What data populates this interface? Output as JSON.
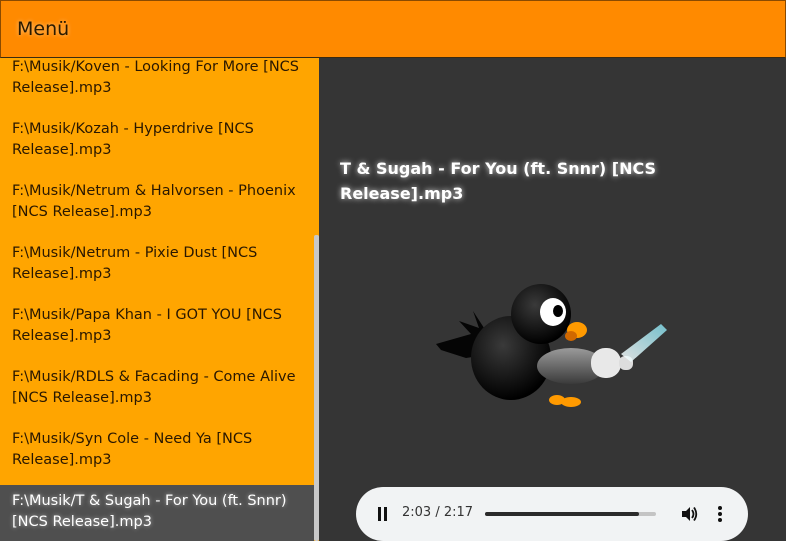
{
  "header": {
    "menu_label": "Menü"
  },
  "playlist": {
    "items": [
      "F:\\Musik/Koven - Looking For More [NCS Release].mp3",
      "F:\\Musik/Kozah - Hyperdrive [NCS Release].mp3",
      "F:\\Musik/Netrum & Halvorsen - Phoenix [NCS Release].mp3",
      "F:\\Musik/Netrum - Pixie Dust [NCS Release].mp3",
      "F:\\Musik/Papa Khan - I GOT YOU [NCS Release].mp3",
      "F:\\Musik/RDLS & Facading - Come Alive [NCS Release].mp3",
      "F:\\Musik/Syn Cole - Need Ya [NCS Release].mp3",
      "F:\\Musik/T & Sugah - For You (ft. Snnr) [NCS Release].mp3"
    ],
    "active_index": 7
  },
  "player": {
    "now_playing": "T & Sugah - For You (ft. Snnr) [NCS Release].mp3",
    "time_display": "2:03 / 2:17",
    "progress": 0.898,
    "state": "playing"
  },
  "icons": {
    "pause": "pause-icon",
    "volume": "volume-icon",
    "more": "more-vert-icon",
    "mascot": "penguin-mascot"
  },
  "colors": {
    "header_bg": "#ff8a00",
    "sidebar_bg": "#ffa500",
    "main_bg": "#353535",
    "active_item_bg": "#4f4f4f",
    "player_bg": "#f1f3f4"
  }
}
